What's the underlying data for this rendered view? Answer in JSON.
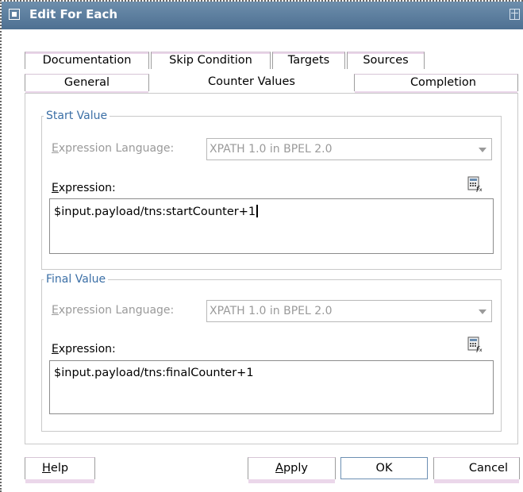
{
  "window": {
    "title": "Edit For Each"
  },
  "tabs": {
    "row1": [
      "Documentation",
      "Skip Condition",
      "Targets",
      "Sources"
    ],
    "row2": [
      "General",
      "Counter Values",
      "Completion"
    ]
  },
  "start": {
    "legend": "Start Value",
    "lang_label_u": "E",
    "lang_label_rest": "xpression Language:",
    "lang_value": "XPATH 1.0 in BPEL 2.0",
    "expr_label_u": "E",
    "expr_label_rest": "xpression:",
    "expr_value": "$input.payload/tns:startCounter+1"
  },
  "final": {
    "legend": "Final Value",
    "lang_label_u": "E",
    "lang_label_rest": "xpression Language:",
    "lang_value": "XPATH 1.0 in BPEL 2.0",
    "expr_label_u": "E",
    "expr_label_rest": "xpression:",
    "expr_value": "$input.payload/tns:finalCounter+1"
  },
  "buttons": {
    "help_u": "H",
    "help_rest": "elp",
    "apply_u": "A",
    "apply_rest": "pply",
    "ok": "OK",
    "cancel": "Cancel"
  }
}
